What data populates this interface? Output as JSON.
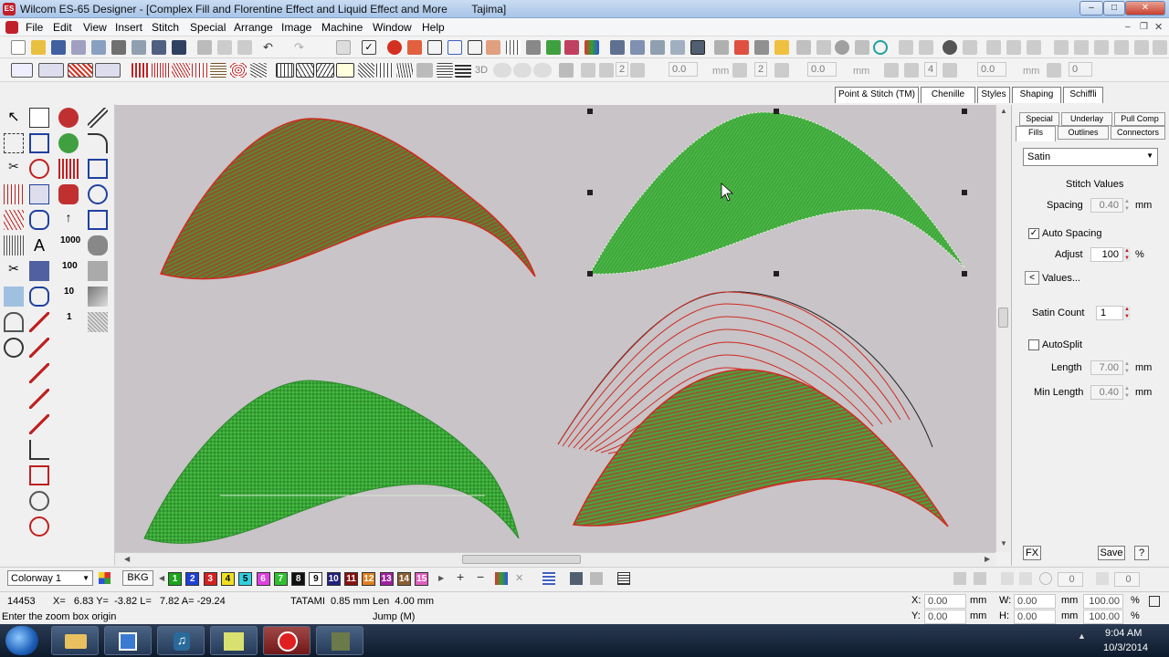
{
  "window": {
    "title": "Wilcom ES-65 Designer - [Complex Fill and Florentine Effect and Liquid Effect and More        Tajima]",
    "app_badge": "ES"
  },
  "menu": [
    "File",
    "Edit",
    "View",
    "Insert",
    "Stitch",
    "Special",
    "Arrange",
    "Image",
    "Machine",
    "Window",
    "Help"
  ],
  "toolbar2": {
    "fields": [
      "2",
      "0.0",
      "2",
      "0.0",
      "4",
      "0.0",
      "0"
    ],
    "unit_mm": "mm",
    "label_3d": "3D"
  },
  "stitch_tabs": [
    "Point & Stitch (TM)",
    "Chenille",
    "Styles",
    "Shaping",
    "Schiffli"
  ],
  "toolbox_numbers": {
    "n1000": "1000",
    "n100": "100",
    "n10": "10",
    "n1": "1"
  },
  "panel": {
    "tabs_row1": [
      "Special",
      "Underlay",
      "Pull Comp"
    ],
    "tabs_row2": [
      "Fills",
      "Outlines",
      "Connectors"
    ],
    "fill_type": "Satin",
    "section_title": "Stitch Values",
    "spacing_label": "Spacing",
    "spacing_value": "0.40",
    "unit_mm": "mm",
    "auto_spacing_label": "Auto Spacing",
    "auto_spacing_checked": true,
    "adjust_label": "Adjust",
    "adjust_value": "100",
    "percent": "%",
    "values_button": "Values...",
    "satin_count_label": "Satin Count",
    "satin_count_value": "1",
    "autosplit_label": "AutoSplit",
    "autosplit_checked": false,
    "length_label": "Length",
    "length_value": "7.00",
    "min_length_label": "Min Length",
    "min_length_value": "0.40",
    "fx_button": "FX",
    "save_button": "Save",
    "help_button": "?"
  },
  "colorbar": {
    "colorway": "Colorway 1",
    "bkg_button": "BKG",
    "swatches": [
      {
        "n": "1",
        "c": "#1aa51a"
      },
      {
        "n": "2",
        "c": "#1f3fd6"
      },
      {
        "n": "3",
        "c": "#d42020"
      },
      {
        "n": "4",
        "c": "#f0e020"
      },
      {
        "n": "5",
        "c": "#30d0e0"
      },
      {
        "n": "6",
        "c": "#e040e0"
      },
      {
        "n": "7",
        "c": "#30c030"
      },
      {
        "n": "8",
        "c": "#101010"
      },
      {
        "n": "9",
        "c": "#ffffff"
      },
      {
        "n": "10",
        "c": "#202080"
      },
      {
        "n": "11",
        "c": "#8a1010"
      },
      {
        "n": "12",
        "c": "#e08020"
      },
      {
        "n": "13",
        "c": "#a020a0"
      },
      {
        "n": "14",
        "c": "#8a6030"
      },
      {
        "n": "15",
        "c": "#e060c0"
      }
    ],
    "right_fields": [
      "0",
      "0"
    ]
  },
  "status": {
    "stitch_count": "14453",
    "coords": "X=   6.83 Y=  -3.82 L=   7.82 A= -29.24",
    "stitch_info": "TATAMI  0.85 mm Len  4.00 mm",
    "prompt": "Enter the zoom box origin",
    "jump": "Jump (M)",
    "x_label": "X:",
    "x_value": "0.00",
    "y_label": "Y:",
    "y_value": "0.00",
    "w_label": "W:",
    "w_value": "0.00",
    "h_label": "H:",
    "h_value": "0.00",
    "unit_mm": "mm",
    "pct1": "100.00",
    "pct2": "100.00",
    "pct_sign": "%"
  },
  "taskbar": {
    "time": "9:04 AM",
    "date": "10/3/2014"
  },
  "colors": {
    "green_fill": "#3fae3a",
    "red_outline": "#d02a20",
    "canvas_bg": "#c8c4c8"
  }
}
